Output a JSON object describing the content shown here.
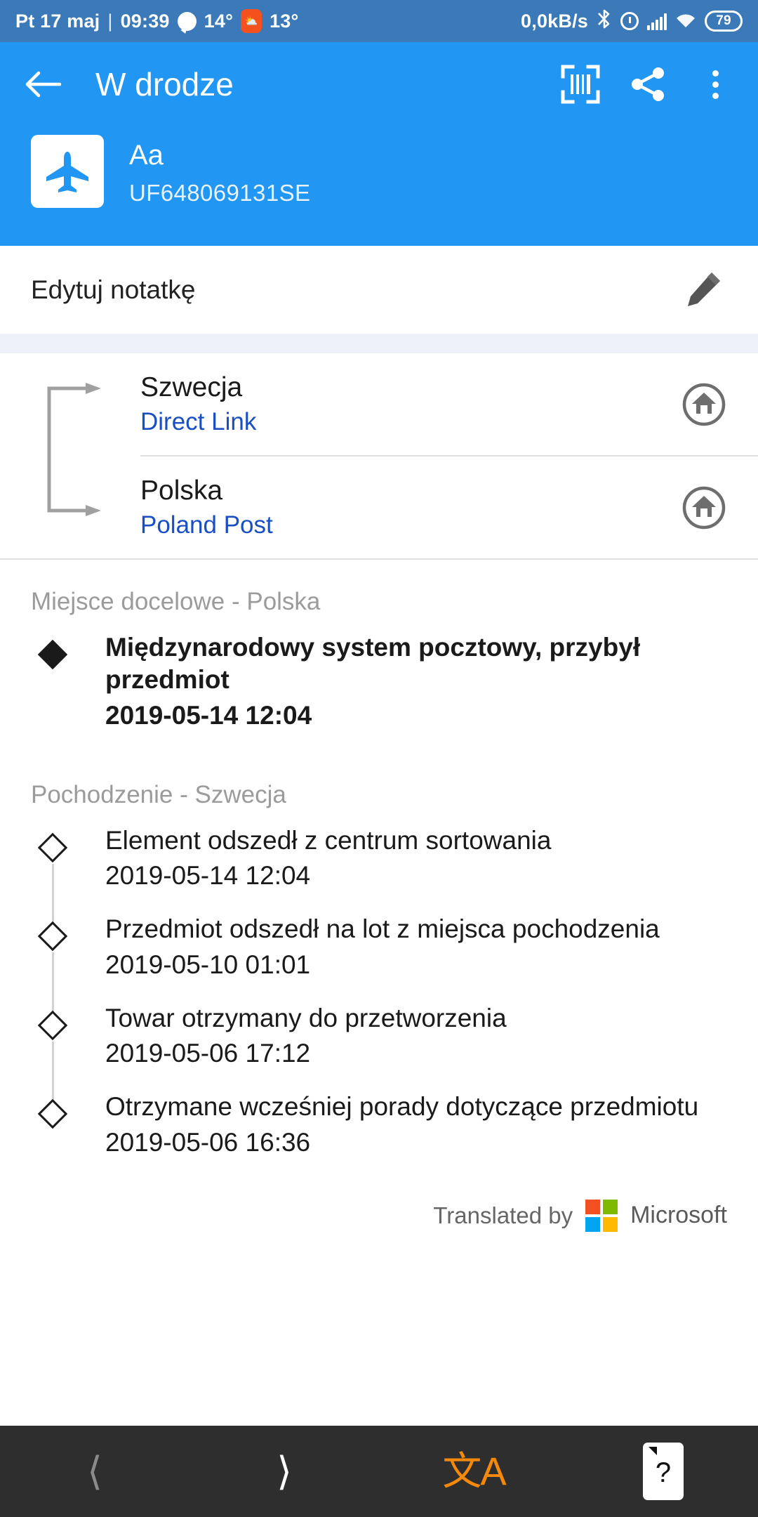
{
  "status_bar": {
    "date": "Pt 17 maj",
    "separator": "|",
    "time": "09:39",
    "weather_icon": "message-bubble-icon",
    "temp_primary": "14°",
    "weather_badge_icon": "weather-widget-icon",
    "temp_secondary": "13°",
    "network_speed": "0,0kB/s",
    "bluetooth_icon": "bluetooth-icon",
    "alarm_icon": "alarm-clock-icon",
    "signal_icon": "cellular-signal-icon",
    "wifi_icon": "wifi-icon",
    "battery_level": "79"
  },
  "app_bar": {
    "back_icon": "back-arrow-icon",
    "title": "W drodze",
    "scan_icon": "barcode-scan-icon",
    "share_icon": "share-icon",
    "overflow_icon": "more-vertical-icon"
  },
  "shipment": {
    "icon": "airplane-icon",
    "name": "Aa",
    "tracking_number": "UF648069131SE"
  },
  "note": {
    "label": "Edytuj notatkę",
    "edit_icon": "pencil-edit-icon"
  },
  "route": {
    "rows": [
      {
        "country": "Szwecja",
        "carrier": "Direct Link",
        "home_icon": "home-circle-icon"
      },
      {
        "country": "Polska",
        "carrier": "Poland Post",
        "home_icon": "home-circle-icon"
      }
    ]
  },
  "sections": [
    {
      "title": "Miejsce docelowe - Polska",
      "events": [
        {
          "bullet": "filled",
          "description": "Międzynarodowy system pocztowy, przybył przedmiot",
          "timestamp": "2019-05-14 12:04",
          "bold": true
        }
      ]
    },
    {
      "title": "Pochodzenie - Szwecja",
      "events": [
        {
          "bullet": "hollow",
          "description": "Element odszedł z centrum sortowania",
          "timestamp": "2019-05-14 12:04",
          "bold": false
        },
        {
          "bullet": "hollow",
          "description": "Przedmiot odszedł na lot z miejsca pochodzenia",
          "timestamp": "2019-05-10 01:01",
          "bold": false
        },
        {
          "bullet": "hollow",
          "description": "Towar otrzymany do przetworzenia",
          "timestamp": "2019-05-06 17:12",
          "bold": false
        },
        {
          "bullet": "hollow",
          "description": "Otrzymane wcześniej porady dotyczące przedmiotu",
          "timestamp": "2019-05-06 16:36",
          "bold": false
        }
      ]
    }
  ],
  "translated_by": {
    "prefix": "Translated by",
    "brand": "Microsoft",
    "logo_colors": [
      "#f25022",
      "#7fba00",
      "#00a4ef",
      "#ffb900"
    ]
  },
  "bottom_nav": {
    "back_icon": "chevron-left-icon",
    "forward_icon": "chevron-right-icon",
    "translate_icon": "translate-icon",
    "translate_glyph": "文A",
    "help_icon": "help-card-icon",
    "help_glyph": "?"
  },
  "colors": {
    "status_bar_bg": "#3b79b8",
    "app_bar_bg": "#2196f3",
    "accent_link": "#1a4fc4",
    "band": "#eef0fa",
    "bottom_nav_bg": "#2e2e2e",
    "translate_orange": "#f5890b"
  }
}
